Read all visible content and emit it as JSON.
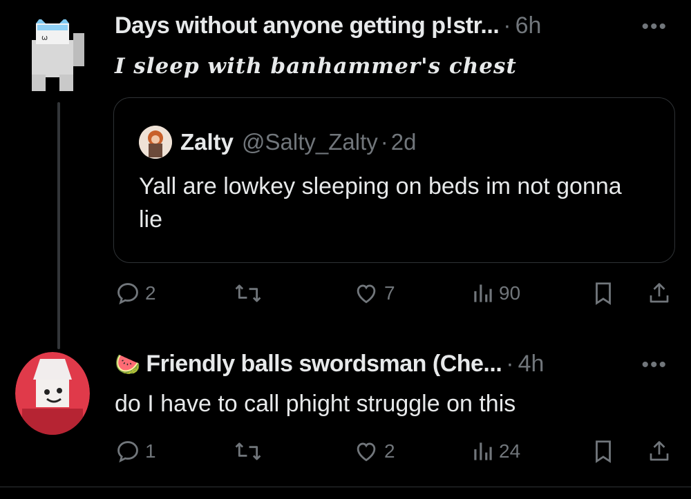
{
  "post1": {
    "author": "Days without anyone getting p!str...",
    "separator": "·",
    "time": "6h",
    "more": "•••",
    "text": "I sleep with banhammer's chest",
    "avatar": "white-robloxian-cat-avatar",
    "quote": {
      "author": "Zalty",
      "handle": "@Salty_Zalty",
      "separator": "·",
      "time": "2d",
      "text": "Yall are lowkey sleeping on beds im not gonna lie"
    },
    "actions": {
      "replies": "2",
      "likes": "7",
      "views": "90"
    }
  },
  "post2": {
    "emoji": "🍉",
    "author": "Friendly balls swordsman (Che...",
    "separator": "·",
    "time": "4h",
    "more": "•••",
    "text": "do I have to call phight struggle on this",
    "avatar": "red-swordsman-avatar",
    "actions": {
      "replies": "1",
      "likes": "2",
      "views": "24"
    }
  },
  "colors": {
    "background": "#000000",
    "text": "#e7e9ea",
    "muted": "#71767b",
    "border": "#2f3336"
  }
}
